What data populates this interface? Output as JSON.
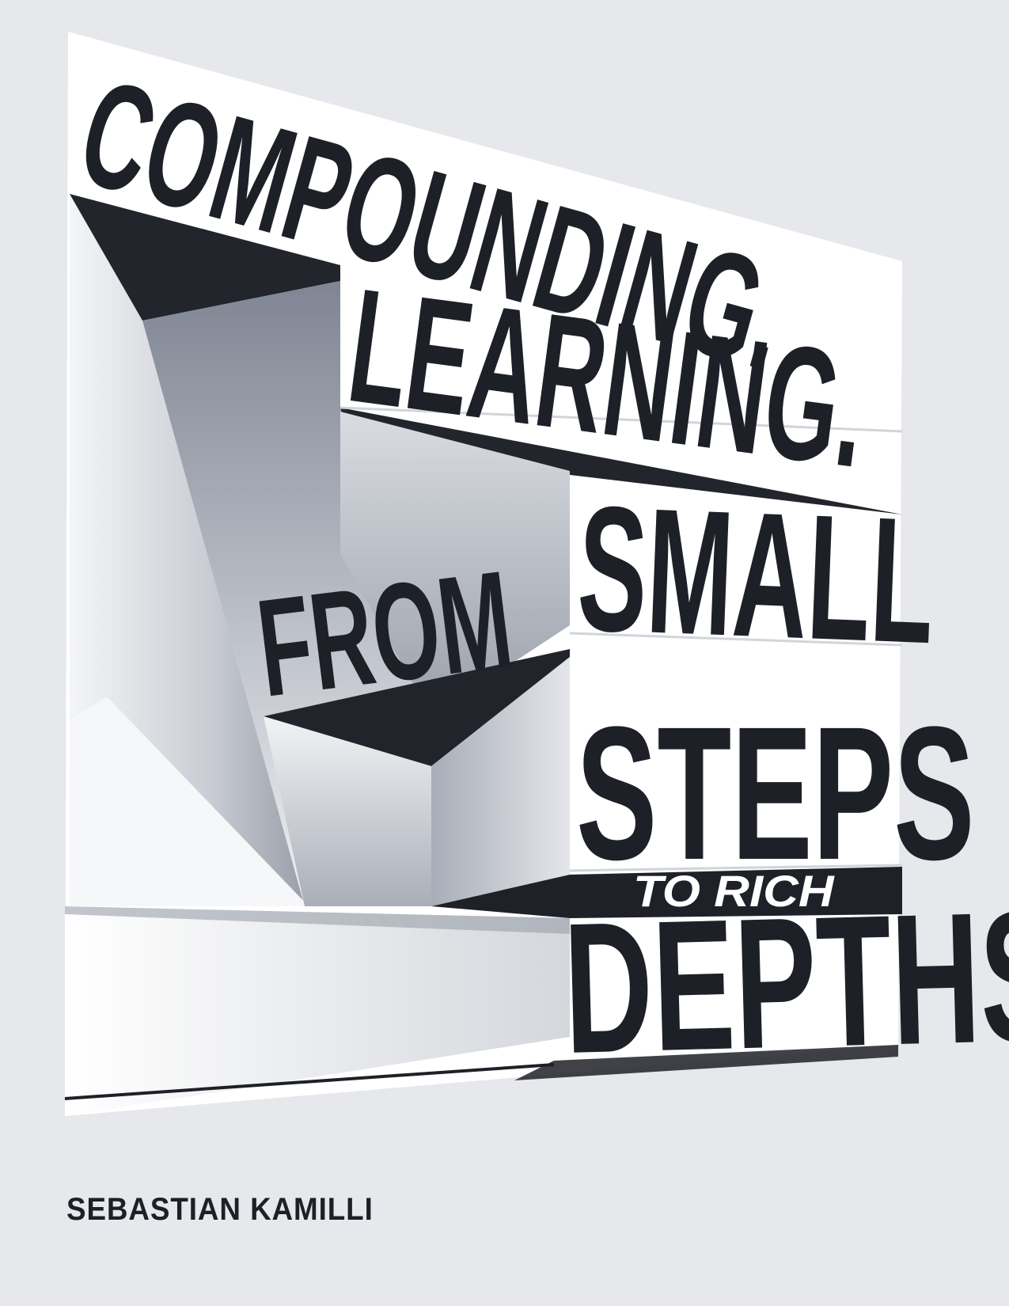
{
  "cover": {
    "title_lines": [
      "COMPOUNDING.",
      "LEARNING.",
      "FROM",
      "SMALL",
      "STEPS",
      "TO RICH",
      "DEPTHS"
    ],
    "author": "SEBASTIAN KAMILLI"
  },
  "colors": {
    "background": "#e6e8eb",
    "ink": "#1e2027",
    "panel": "#ffffff"
  }
}
